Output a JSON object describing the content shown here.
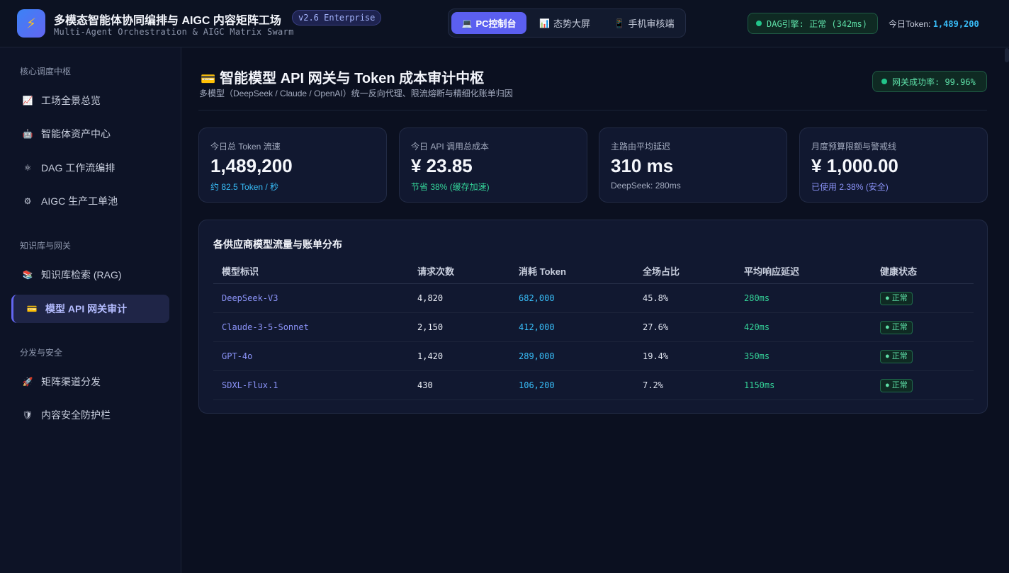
{
  "header": {
    "logo_icon": "lightning-icon",
    "title": "多模态智能体协同编排与 AIGC 内容矩阵工场",
    "subtitle": "Multi-Agent Orchestration & AIGC Matrix Swarm",
    "version": "v2.6 Enterprise",
    "views": [
      {
        "icon": "💻",
        "label": "PC控制台",
        "active": true
      },
      {
        "icon": "📊",
        "label": "态势大屏",
        "active": false
      },
      {
        "icon": "📱",
        "label": "手机审核端",
        "active": false
      }
    ],
    "engine_status": "DAG引擎: 正常 (342ms)",
    "token_today_label": "今日Token:",
    "token_today_value": "1,489,200"
  },
  "sidebar": {
    "sections": [
      {
        "title": "核心调度中枢",
        "items": [
          {
            "icon": "📈",
            "label": "工场全景总览"
          },
          {
            "icon": "🤖",
            "label": "智能体资产中心"
          },
          {
            "icon": "⚛",
            "label": "DAG 工作流编排"
          },
          {
            "icon": "⚙",
            "label": "AIGC 生产工单池"
          }
        ]
      },
      {
        "title": "知识库与网关",
        "items": [
          {
            "icon": "📚",
            "label": "知识库检索 (RAG)"
          },
          {
            "icon": "💳",
            "label": "模型 API 网关审计",
            "active": true
          }
        ]
      },
      {
        "title": "分发与安全",
        "items": [
          {
            "icon": "🚀",
            "label": "矩阵渠道分发"
          },
          {
            "icon": "🛡",
            "label": "内容安全防护栏"
          }
        ]
      }
    ]
  },
  "main": {
    "title_icon": "💳",
    "title": "智能模型 API 网关与 Token 成本审计中枢",
    "subtitle": "多模型（DeepSeek / Claude / OpenAI）统一反向代理、限流熔断与精细化账单归因",
    "gateway_rate": "网关成功率: 99.96%",
    "kpis": [
      {
        "label": "今日总 Token 流速",
        "value": "1,489,200",
        "note": "约 82.5 Token / 秒",
        "note_color": "#38bdf8"
      },
      {
        "label": "今日 API 调用总成本",
        "value": "¥ 23.85",
        "note": "节省 38% (缓存加速)",
        "note_color": "#34d399"
      },
      {
        "label": "主路由平均延迟",
        "value": "310 ms",
        "note": "DeepSeek: 280ms",
        "note_color": "#a3abbf"
      },
      {
        "label": "月度预算限额与警戒线",
        "value": "¥ 1,000.00",
        "note": "已使用 2.38% (安全)",
        "note_color": "#8b93f8"
      }
    ],
    "table": {
      "title": "各供应商模型流量与账单分布",
      "columns": [
        "模型标识",
        "请求次数",
        "消耗 Token",
        "全场占比",
        "平均响应延迟",
        "健康状态"
      ],
      "rows": [
        {
          "model": "DeepSeek-V3",
          "requests": "4,820",
          "tokens": "682,000",
          "share": "45.8%",
          "latency": "280ms",
          "health": "● 正常"
        },
        {
          "model": "Claude-3-5-Sonnet",
          "requests": "2,150",
          "tokens": "412,000",
          "share": "27.6%",
          "latency": "420ms",
          "health": "● 正常"
        },
        {
          "model": "GPT-4o",
          "requests": "1,420",
          "tokens": "289,000",
          "share": "19.4%",
          "latency": "350ms",
          "health": "● 正常"
        },
        {
          "model": "SDXL-Flux.1",
          "requests": "430",
          "tokens": "106,200",
          "share": "7.2%",
          "latency": "1150ms",
          "health": "● 正常"
        }
      ]
    }
  }
}
